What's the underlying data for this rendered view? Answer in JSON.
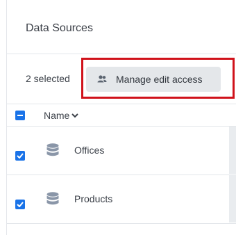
{
  "header": {
    "title": "Data Sources"
  },
  "selection": {
    "count_label": "2 selected",
    "manage_label": "Manage edit access"
  },
  "table": {
    "column_name": "Name",
    "rows": [
      {
        "label": "Offices",
        "checked": true
      },
      {
        "label": "Products",
        "checked": true
      }
    ]
  },
  "colors": {
    "accent": "#1a73e8",
    "highlight": "#d0121b",
    "icon": "#8a96a8"
  },
  "icons": {
    "manage": "people-icon",
    "sort": "chevron-down-icon",
    "row": "database-icon",
    "select_all": "minus-checkbox-icon",
    "row_check": "check-icon"
  }
}
